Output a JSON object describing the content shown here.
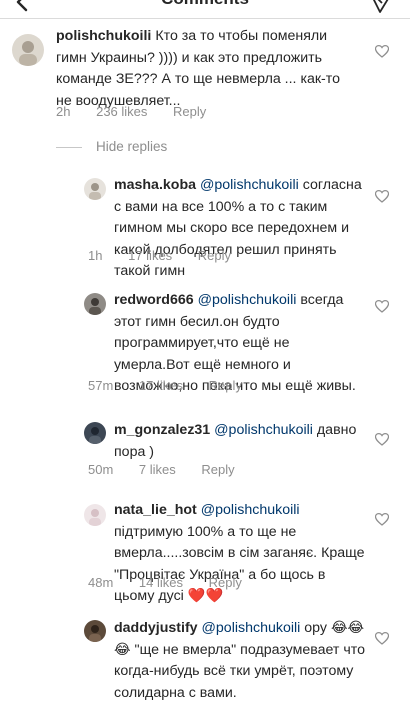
{
  "header": {
    "title": "Comments"
  },
  "hide_replies": "Hide replies",
  "comments": [
    {
      "username": "polishchukoili",
      "mention": "",
      "text": "Кто за то чтобы поменяли гимн Украины? )))) и как это предложить команде ЗЕ??? А то ще невмерла ... как-то не воодушевляет...",
      "time": "2h",
      "likes": "236 likes",
      "reply": "Reply"
    },
    {
      "username": "masha.koba",
      "mention": "@polishchukoili",
      "text": "согласна с вами на все 100% а то с таким гимном мы скоро все передохнем и какой долбодятел решил принять такой гимн",
      "time": "1h",
      "likes": "17 likes",
      "reply": "Reply"
    },
    {
      "username": "redword666",
      "mention": "@polishchukoili",
      "text": "всегда этот гимн бесил.он будто программирует,что ещё не умерла.Вот ещё немного и возможно,но пока что мы ещё живы.",
      "time": "57m",
      "likes": "17 likes",
      "reply": "Reply"
    },
    {
      "username": "m_gonzalez31",
      "mention": "@polishchukoili",
      "text": "давно пора )",
      "time": "50m",
      "likes": "7 likes",
      "reply": "Reply"
    },
    {
      "username": "nata_lie_hot",
      "mention": "@polishchukoili",
      "text": "підтримую 100% а то ще не вмерла.....зовсім в сім заганяє. Краще \"Процвітає Україна\" а бо щось в цьому дусі",
      "emoji": "❤️❤️",
      "time": "48m",
      "likes": "14 likes",
      "reply": "Reply"
    },
    {
      "username": "daddyjustify",
      "mention": "@polishchukoili",
      "text_pre": "ору",
      "emoji": "😂😂😂",
      "text": "\"ще не вмерла\" подразумевает что когда-нибудь всё тки умрёт, поэтому солидарна с вами."
    }
  ]
}
